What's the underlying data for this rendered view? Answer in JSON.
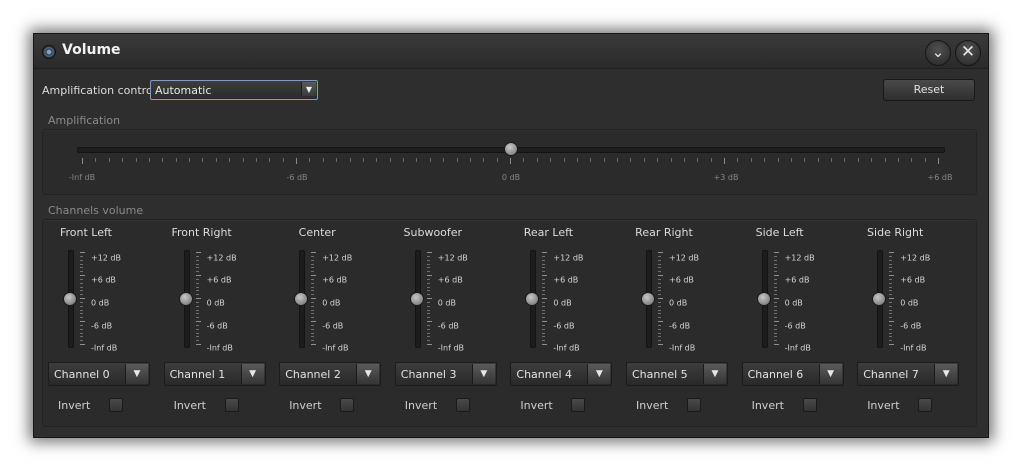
{
  "window": {
    "title": "Volume"
  },
  "icons": {
    "app": "volume-app-icon",
    "collapse": "chevron-down-icon",
    "close": "close-icon"
  },
  "colors": {
    "window_bg": "#2e2e2e",
    "accent": "#7d9ec2",
    "text": "#d8d8d8"
  },
  "amplification_control": {
    "label": "Amplification control:",
    "selected": "Automatic",
    "arrow": "▼"
  },
  "reset_label": "Reset",
  "amplification": {
    "group_label": "Amplification",
    "value_fraction": 0.5,
    "tick_labels": [
      "-Inf dB",
      "-6 dB",
      "0 dB",
      "+3 dB",
      "+6 dB"
    ]
  },
  "channels_volume": {
    "group_label": "Channels volume",
    "db_labels": [
      "+12 dB",
      "+6 dB",
      "0 dB",
      "-6 dB",
      "-Inf dB"
    ],
    "invert_label": "Invert",
    "arrow": "▼",
    "channels": [
      {
        "name": "Front Left",
        "selected": "Channel 0",
        "level_fraction": 0.5,
        "invert": false
      },
      {
        "name": "Front Right",
        "selected": "Channel 1",
        "level_fraction": 0.5,
        "invert": false
      },
      {
        "name": "Center",
        "selected": "Channel 2",
        "level_fraction": 0.5,
        "invert": false
      },
      {
        "name": "Subwoofer",
        "selected": "Channel 3",
        "level_fraction": 0.5,
        "invert": false
      },
      {
        "name": "Rear Left",
        "selected": "Channel 4",
        "level_fraction": 0.5,
        "invert": false
      },
      {
        "name": "Rear Right",
        "selected": "Channel 5",
        "level_fraction": 0.5,
        "invert": false
      },
      {
        "name": "Side Left",
        "selected": "Channel 6",
        "level_fraction": 0.5,
        "invert": false
      },
      {
        "name": "Side Right",
        "selected": "Channel 7",
        "level_fraction": 0.5,
        "invert": false
      }
    ]
  }
}
